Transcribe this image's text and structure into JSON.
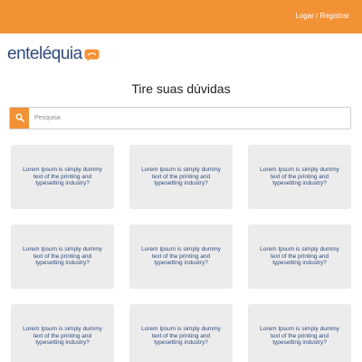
{
  "header": {
    "auth_label": "Logar / Registrar",
    "bar_color": "#f39235"
  },
  "brand": {
    "logo_text": "enteléquia",
    "logo_icon": "speech-bubble-icon",
    "color": "#2f4a7e"
  },
  "page": {
    "title": "Tire suas dúvidas"
  },
  "search": {
    "placeholder": "Pesquisa",
    "value": "",
    "icon": "search-icon"
  },
  "cards": [
    {
      "text": "Lorem Ipsum is simply dummy text of the printing and typesetting industry?"
    },
    {
      "text": "Lorem Ipsum is simply dummy text of the printing and typesetting industry?"
    },
    {
      "text": "Lorem Ipsum is simply dummy text of the printing and typesetting industry?"
    },
    {
      "text": "Lorem Ipsum is simply dummy text of the printing and typesetting industry?"
    },
    {
      "text": "Lorem Ipsum is simply dummy text of the printing and typesetting industry?"
    },
    {
      "text": "Lorem Ipsum is simply dummy text of the printing and typesetting industry?"
    },
    {
      "text": "Lorem Ipsum is simply dummy text of the printing and typesetting industry?"
    },
    {
      "text": "Lorem Ipsum is simply dummy text of the printing and typesetting industry?"
    },
    {
      "text": "Lorem Ipsum is simply dummy text of the printing and typesetting industry?"
    }
  ]
}
